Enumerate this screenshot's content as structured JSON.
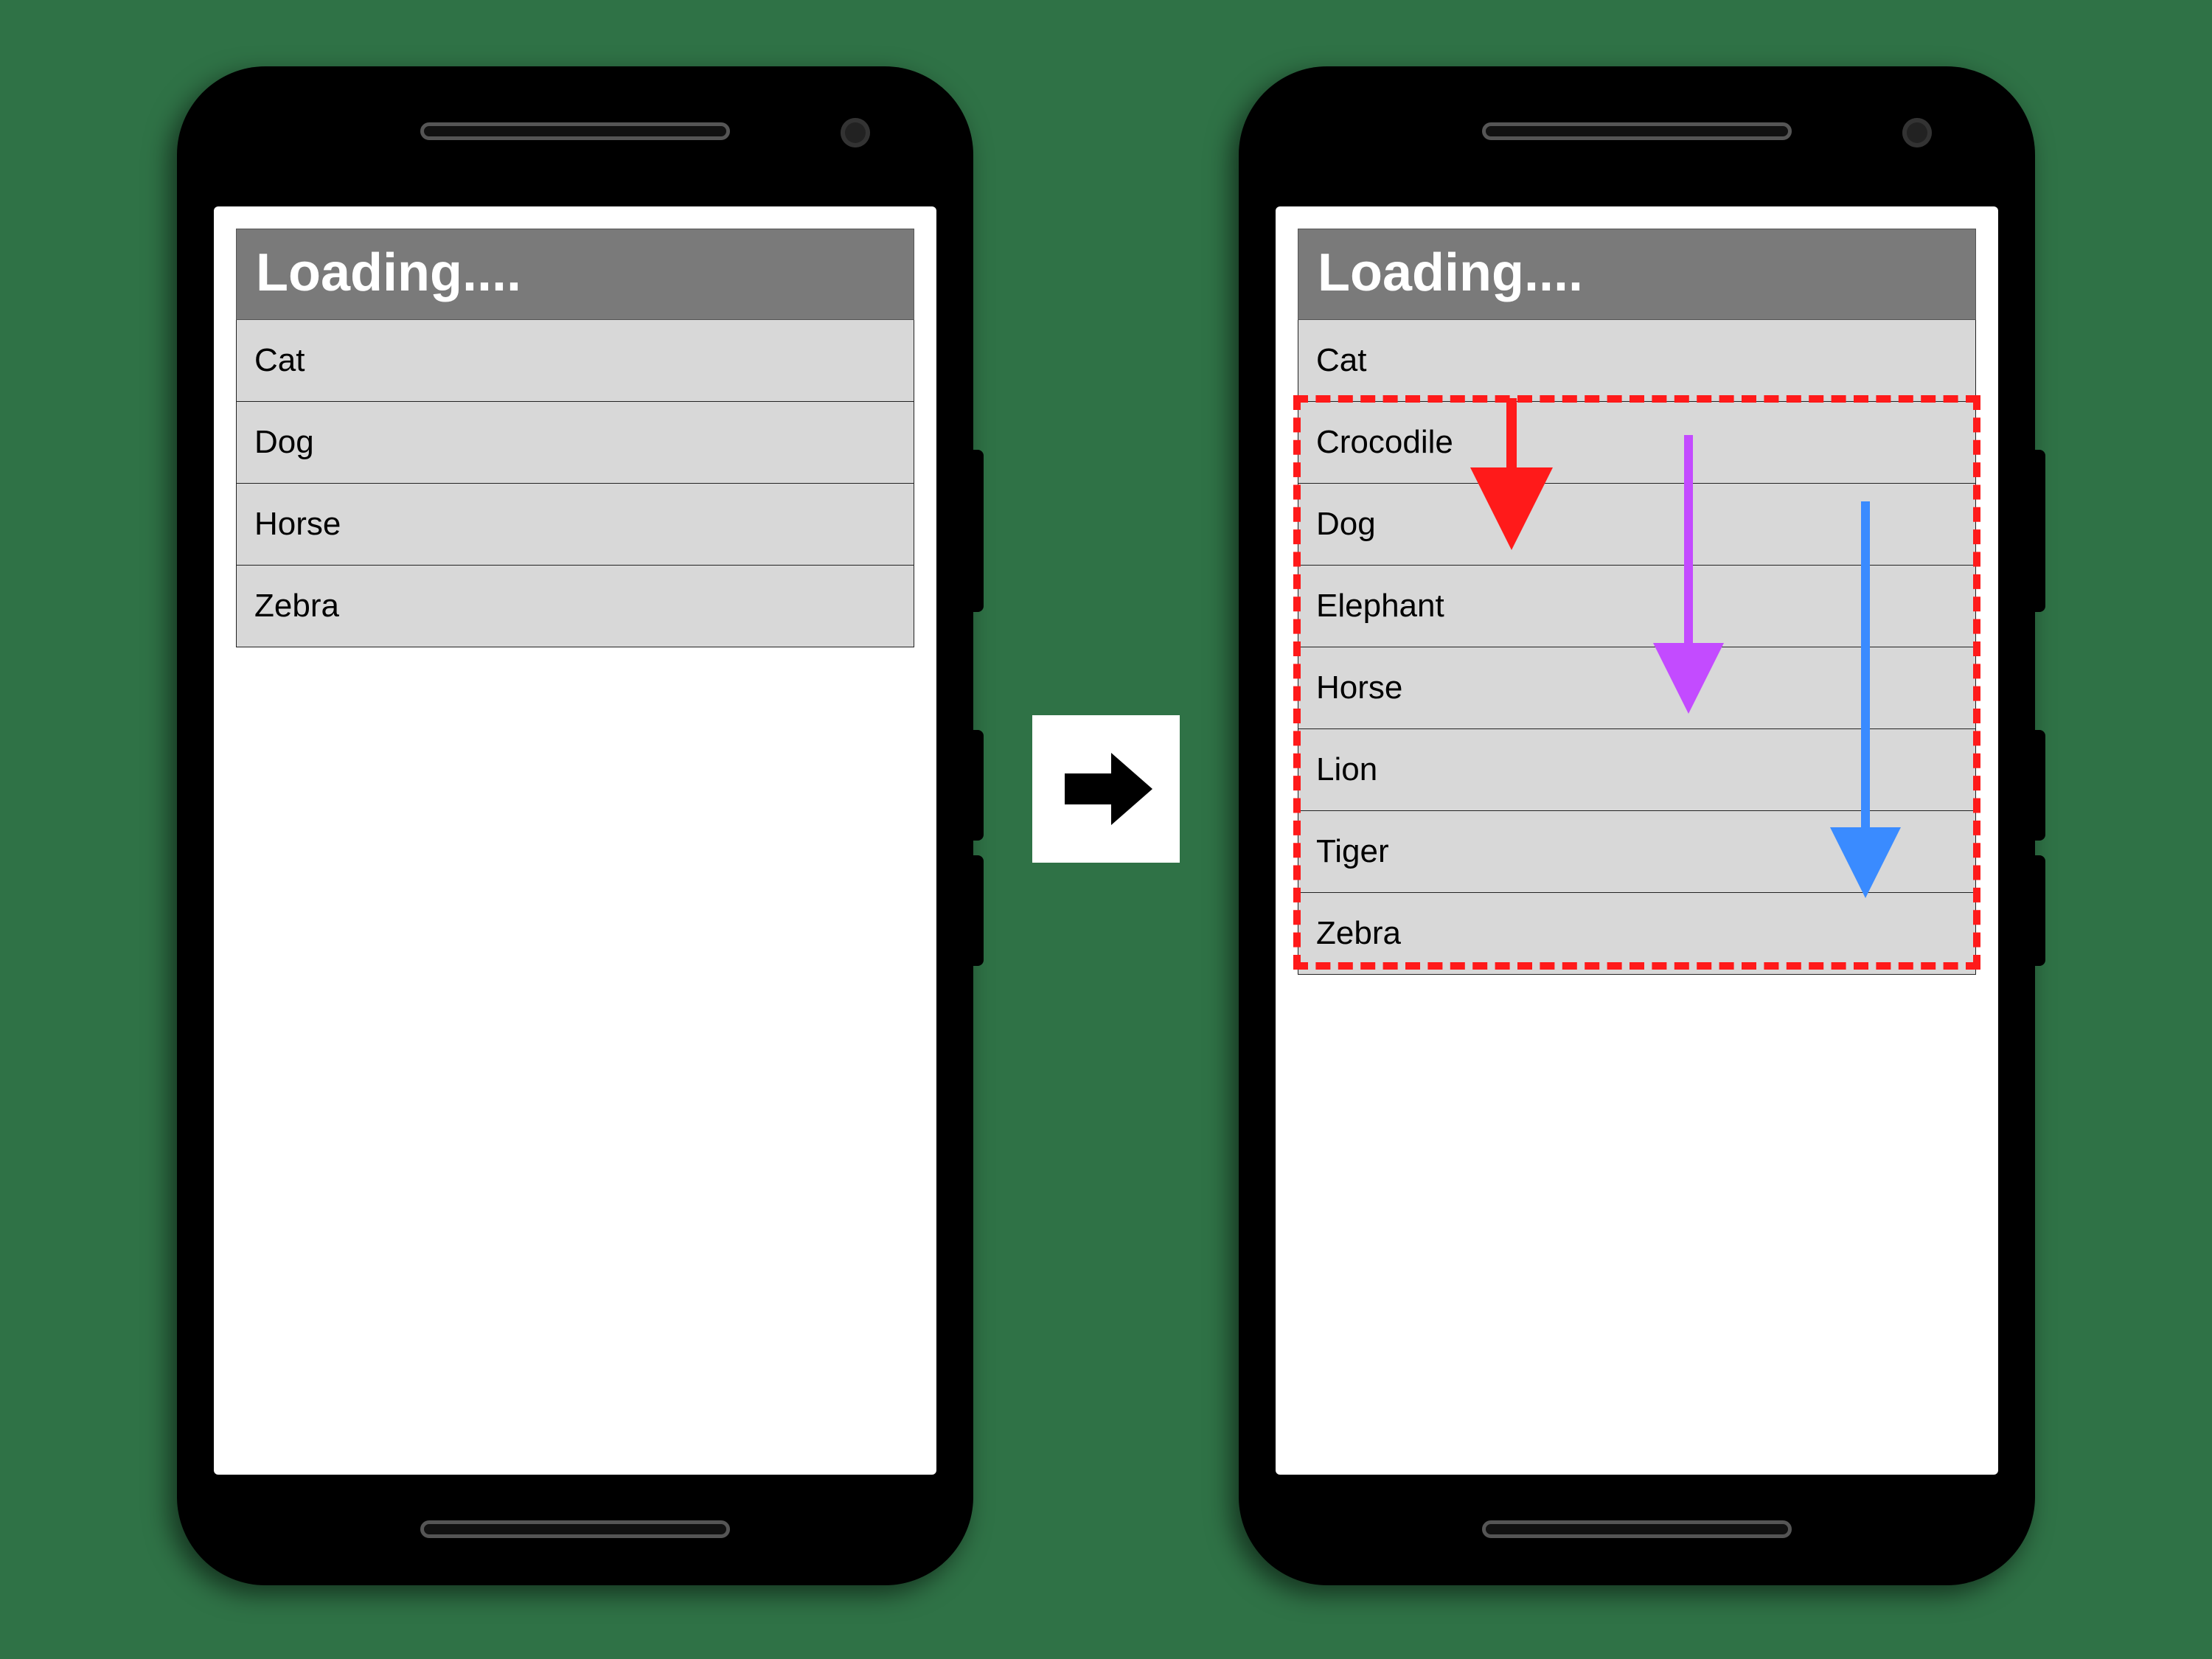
{
  "left_phone": {
    "header": "Loading....",
    "rows": [
      "Cat",
      "Dog",
      "Horse",
      "Zebra"
    ]
  },
  "right_phone": {
    "header": "Loading....",
    "rows": [
      "Cat",
      "Crocodile",
      "Dog",
      "Elephant",
      "Horse",
      "Lion",
      "Tiger",
      "Zebra"
    ]
  },
  "arrows": {
    "red": "#ff1a1a",
    "purple": "#c34bff",
    "blue": "#3a8bff"
  },
  "highlight_color": "#ff1a1a",
  "transition_icon": "arrow-right"
}
